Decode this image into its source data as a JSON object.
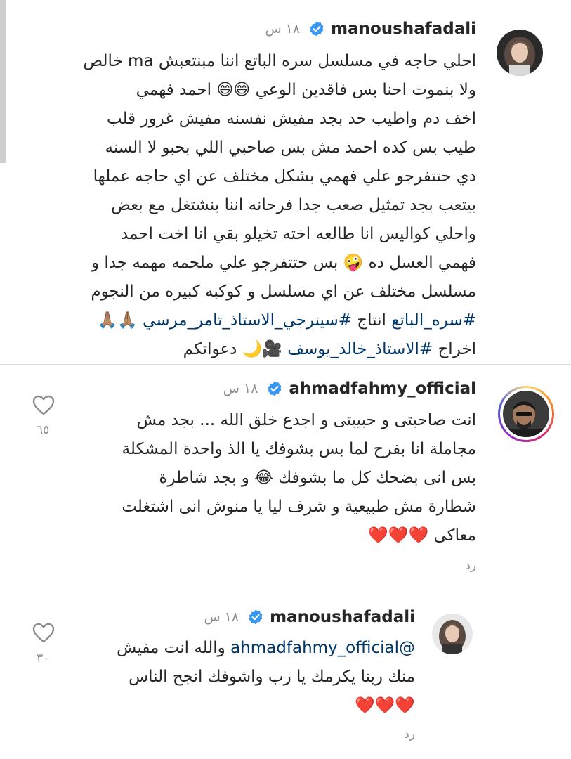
{
  "post": {
    "username": "manoushafadali",
    "time": "١٨ س",
    "caption_lines": [
      "احلي حاجه في مسلسل سره الباتع اننا مبنتعبش ma خالص",
      "ولا بنموت احنا بس فاقدين الوعي 😄😄 احمد فهمي",
      "اخف دم واطيب حد بجد مفيش نفسنه مفيش غرور قلب",
      "طيب بس كده احمد مش بس صاحبي اللي بحبو لا السنه",
      "دي حتتفرجو علي فهمي بشكل مختلف عن اي حاجه عملها",
      "بيتعب بجد تمثيل صعب جدا فرحانه اننا بنشتغل مع بعض",
      "واحلي كواليس انا طالعه اخته تخيلو بقي انا اخت احمد",
      "فهمي العسل ده 🤪 بس حتتفرجو علي ملحمه مهمه جدا و",
      "مسلسل مختلف عن اي مسلسل و كوكبه كبيره من النجوم"
    ],
    "hashtags_line": "#سره_الباتع انتاج #سينرجي_الاستاذ_تامر_مرسي 🙏🏽🙏🏽",
    "hashtags_line_prefix": "🙏🏽🙏🏽 ",
    "hashtag_1": "#سره_الباتع",
    "word_produce": " انتاج ",
    "hashtag_2": "#سينرجي_الاستاذ_تامر_مرسي",
    "last_line_prefix": "اخراج ",
    "hashtag_3": "#الاستاذ_خالد_يوسف",
    "last_line_suffix": " 🎥🌙 دعواتكم"
  },
  "comments": [
    {
      "username": "ahmadfahmy_official",
      "time": "١٨ س",
      "lines": [
        "انت صاحبتى و حبيبتى و اجدع خلق الله ... بجد مش",
        "مجاملة  انا بفرح لما بس بشوفك يا الذ  واحدة المشكلة",
        "بس انى بضحك كل ما بشوفك 😂 و بجد شاطرة",
        "شطارة مش طبيعية و شرف ليا يا منوش انى اشتغلت",
        "معاكى ❤️❤️❤️"
      ],
      "like_count": "٦٥",
      "reply_label": "رد"
    },
    {
      "username": "manoushafadali",
      "time": "١٨ س",
      "mention": "@ahmadfahmy_official",
      "line1_text": " والله انت مفيش",
      "lines": [
        "منك ربنا يكرمك يا رب واشوفك انجح الناس",
        "❤️❤️❤️"
      ],
      "like_count": "٣٠",
      "reply_label": "رد"
    }
  ],
  "icons": {
    "verified": "verified-badge-icon",
    "like": "heart-outline-icon"
  },
  "colors": {
    "verified_blue": "#3897f0",
    "link_blue": "#00376b",
    "muted_gray": "#8e8e8e"
  }
}
